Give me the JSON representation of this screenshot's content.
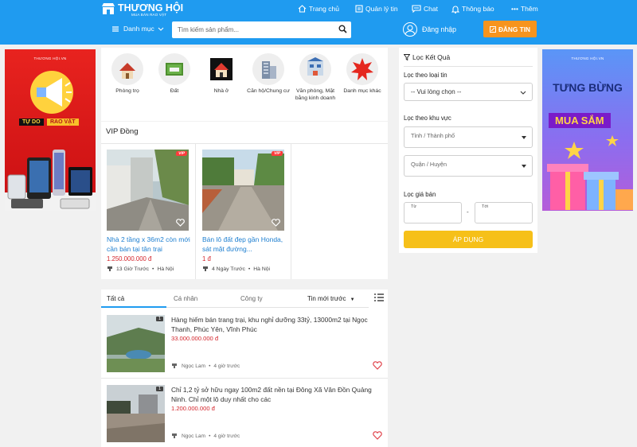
{
  "brand": {
    "name": "THƯƠNG HỘI",
    "tagline": "MUA BÁN RAO VẶT"
  },
  "topnav": {
    "home": "Trang chủ",
    "manage": "Quản lý tin",
    "chat": "Chat",
    "notify": "Thông báo",
    "more": "Thêm"
  },
  "header": {
    "category_label": "Danh mục",
    "search_placeholder": "Tìm kiếm sản phẩm...",
    "login_label": "Đăng nhập",
    "post_label": "ĐĂNG TIN"
  },
  "banner_left": {
    "brand": "THƯƠNG HỘI.VN",
    "tag1": "TỰ DO",
    "tag2": "RAO VẶT"
  },
  "banner_right": {
    "brand": "THƯƠNG HỘI.VN",
    "line1": "TƯNG BỪNG",
    "line2": "MUA SẮM"
  },
  "categories": [
    {
      "label": "Phòng trọ",
      "icon": "house-icon"
    },
    {
      "label": "Đất",
      "icon": "land-icon"
    },
    {
      "label": "Nhà ở",
      "icon": "home-icon"
    },
    {
      "label": "Căn hộ/Chung cư",
      "icon": "apartment-icon"
    },
    {
      "label": "Văn phòng, Mặt bằng kinh doanh",
      "icon": "office-icon"
    },
    {
      "label": "Danh mục khác",
      "icon": "hot-icon"
    }
  ],
  "vip": {
    "title": "VIP Đồng",
    "badge": "VIP",
    "items": [
      {
        "title": "Nhà 2 tầng x 36m2 còn mới cần bán tại tân trại",
        "price": "1.250.000.000 đ",
        "time": "13 Giờ Trước",
        "location": "Hà Nội"
      },
      {
        "title": "Bán lô đất đẹp gần Honda, sát mặt đường...",
        "price": "1 đ",
        "time": "4 Ngày Trước",
        "location": "Hà Nội"
      }
    ]
  },
  "listing": {
    "tabs": [
      "Tất cả",
      "Cá nhân",
      "Công ty"
    ],
    "sort": "Tin mới trước",
    "items": [
      {
        "count": "1",
        "title": "Hàng hiếm bán trang trại, khu nghỉ dưỡng 33tỷ, 13000m2 tại Ngọc Thanh, Phúc Yên, Vĩnh Phúc",
        "price": "33.000.000.000 đ",
        "user": "Ngọc Lam",
        "time": "4 giờ trước"
      },
      {
        "count": "1",
        "title": "Chỉ 1,2 tỷ sở hữu ngay 100m2 đất nền tại Đông Xã Vân Đồn Quảng Ninh. Chỉ một lô duy nhất cho các",
        "price": "1.200.000.000 đ",
        "user": "Ngọc Lam",
        "time": "4 giờ trước"
      }
    ]
  },
  "filter": {
    "title": "Lọc Kết Quả",
    "type_label": "Lọc theo loại tin",
    "type_value": "-- Vui lòng chọn --",
    "area_label": "Lọc theo khu vực",
    "province_placeholder": "Tỉnh / Thành phố",
    "district_placeholder": "Quận / Huyện",
    "price_label": "Lọc giá bán",
    "from_label": "Từ",
    "to_label": "Tới",
    "dash": "-",
    "apply_label": "ÁP DỤNG"
  },
  "colors": {
    "header": "#1f9bf0",
    "post_button": "#f7941d",
    "apply_button": "#f6c019",
    "price": "#d3242b",
    "vip_title": "#1e7fd0"
  }
}
